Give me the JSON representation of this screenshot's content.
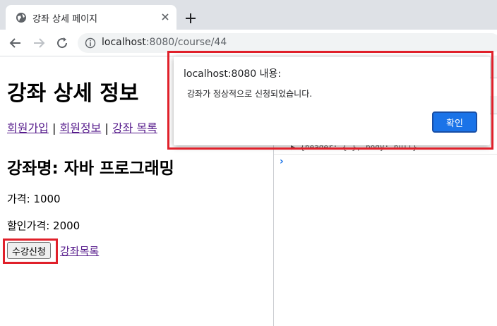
{
  "browser": {
    "tab_title": "강좌 상세 페이지",
    "url_host": "localhost",
    "url_rest": ":8080/course/44"
  },
  "page": {
    "title": "강좌 상세 정보",
    "nav": {
      "signup": "회원가입",
      "sep1": "|",
      "member_info": "회원정보",
      "sep2": "|",
      "course_list": "강좌 목록"
    },
    "course_name": "강좌명: 자바 프로그래밍",
    "price": "가격: 1000",
    "discount_price": "할인가격: 2000",
    "enroll_button": "수강신청",
    "course_list_link": "강좌목록"
  },
  "devtools": {
    "console_line": "▶ {header: {…}, body: null}",
    "prompt": "›"
  },
  "dialog": {
    "title": "localhost:8080 내용:",
    "message": "강좌가 정상적으로 신청되었습니다.",
    "ok_button": "확인"
  },
  "colors": {
    "highlight": "#e0202a",
    "primary_button": "#1a73e8",
    "visited_link": "#551a8b"
  }
}
